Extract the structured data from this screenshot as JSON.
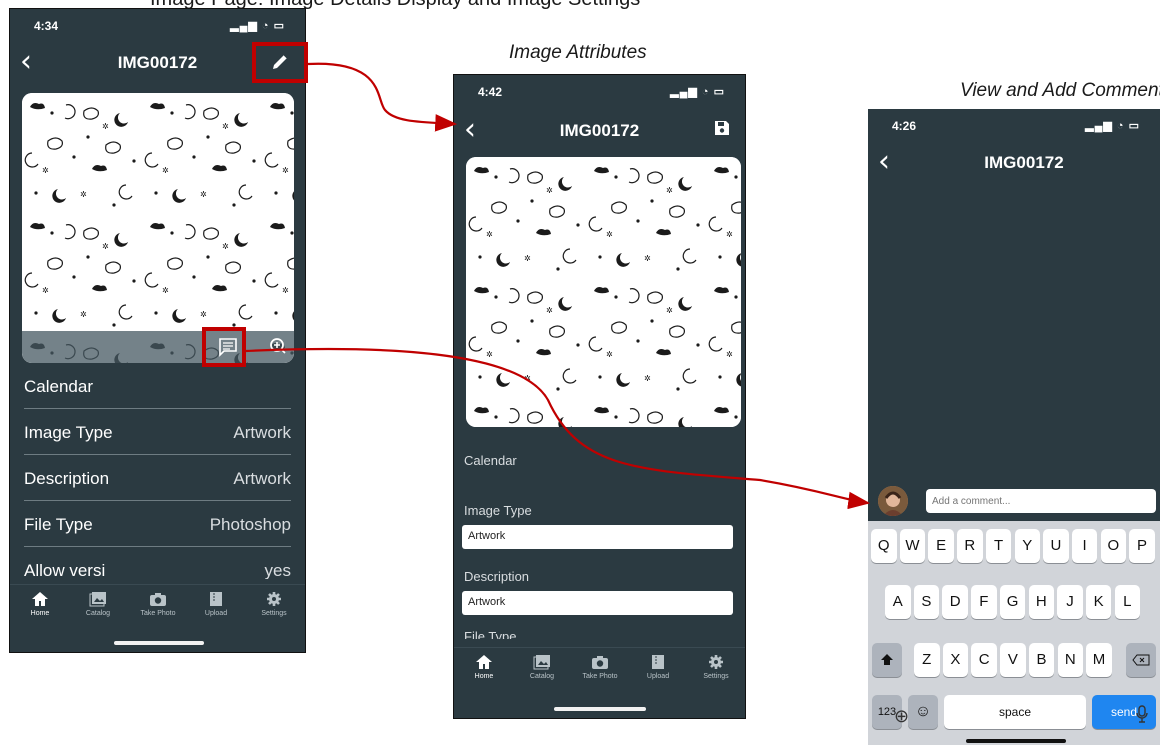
{
  "header_cut_text": "Image Page: Image Details Display and Image Settings",
  "captions": {
    "attributes": "Image Attributes",
    "comments": "View and Add Comments"
  },
  "phone1": {
    "time": "4:34",
    "title": "IMG00172",
    "rows": [
      {
        "label": "Calendar",
        "value": ""
      },
      {
        "label": "Image Type",
        "value": "Artwork"
      },
      {
        "label": "Description",
        "value": "Artwork"
      },
      {
        "label": "File Type",
        "value": "Photoshop"
      },
      {
        "label": "Allow versi",
        "value": "yes"
      }
    ]
  },
  "phone2": {
    "time": "4:42",
    "title": "IMG00172",
    "calendar_label": "Calendar",
    "image_type_label": "Image Type",
    "image_type_value": "Artwork",
    "description_label": "Description",
    "description_value": "Artwork",
    "file_type_label": "File Type"
  },
  "phone3": {
    "time": "4:26",
    "title": "IMG00172",
    "comment_placeholder": "Add a comment...",
    "keyboard": {
      "row1": [
        "Q",
        "W",
        "E",
        "R",
        "T",
        "Y",
        "U",
        "I",
        "O",
        "P"
      ],
      "row2": [
        "A",
        "S",
        "D",
        "F",
        "G",
        "H",
        "J",
        "K",
        "L"
      ],
      "row3": [
        "Z",
        "X",
        "C",
        "V",
        "B",
        "N",
        "M"
      ],
      "numbers_key": "123",
      "space_key": "space",
      "send_key": "send"
    }
  },
  "tabs": [
    {
      "label": "Home",
      "icon": "home-icon"
    },
    {
      "label": "Catalog",
      "icon": "catalog-icon"
    },
    {
      "label": "Take Photo",
      "icon": "camera-icon"
    },
    {
      "label": "Upload",
      "icon": "upload-icon"
    },
    {
      "label": "Settings",
      "icon": "gear-icon"
    }
  ],
  "colors": {
    "app_background": "#2b3a41",
    "highlight": "#c00000",
    "send_button": "#1f86f0"
  }
}
